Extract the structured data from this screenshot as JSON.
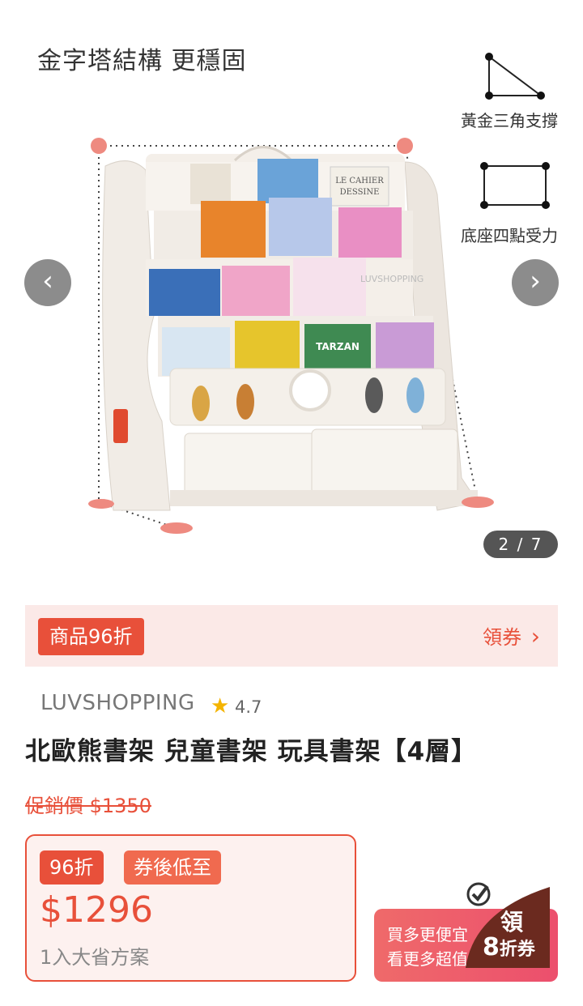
{
  "gallery": {
    "headline": "金字塔結構 更穩固",
    "diagram_triangle_label": "黃金三角支撐",
    "diagram_rect_label": "底座四點受力",
    "prev_icon": "chevron-left-icon",
    "next_icon": "chevron-right-icon",
    "counter": "2 / 7",
    "image_book_labels": [
      "LE CAHIER DESSINE",
      "TARZAN"
    ],
    "watermark": "LUVSHOPPING"
  },
  "coupon_bar": {
    "tag": "商品96折",
    "link": "領券",
    "link_icon": "chevron-right-icon"
  },
  "product": {
    "brand": "LUVSHOPPING",
    "rating": "4.7",
    "title": "北歐熊書架 兒童書架 玩具書架【4層】",
    "promo_price": "促銷價 $1350"
  },
  "price_box": {
    "discount_pill": "96折",
    "after_coupon_pill": "券後低至",
    "price": "$1296",
    "plan": "1入大省方案"
  },
  "bulk_button": {
    "line1": "買多更便宜",
    "line2": "看更多超值",
    "ribbon_top": "領",
    "ribbon_num": "8",
    "ribbon_suffix": "折券"
  },
  "colors": {
    "accent": "#e8503a",
    "coupon_bg": "#fbe9e7",
    "ribbon": "#6b2a1f"
  }
}
